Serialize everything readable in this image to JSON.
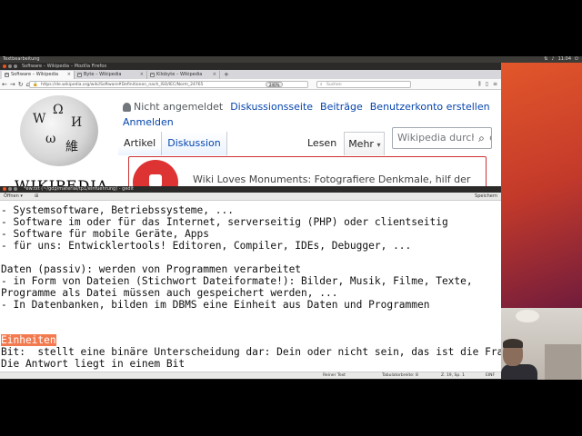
{
  "top_panel": {
    "app_title": "Textbearbeitung",
    "clock": "11:04"
  },
  "firefox": {
    "window_title": "Software – Wikipedia – Mozilla Firefox",
    "tabs": [
      {
        "label": "Software – Wikipedia",
        "active": true
      },
      {
        "label": "Byte – Wikipedia",
        "active": false
      },
      {
        "label": "Kilobyte – Wikipedia",
        "active": false
      }
    ],
    "new_tab": "+",
    "url": "https://de.wikipedia.org/wiki/Software#Definitionen_nach_ISO/IEC/Norm_24765",
    "zoom": "240%",
    "search_placeholder": "Suchen"
  },
  "wikipedia": {
    "wordmark": "WIKIPEDIA",
    "not_logged_in": "Nicht angemeldet",
    "personal_links": [
      "Diskussionsseite",
      "Beiträge",
      "Benutzerkonto erstellen"
    ],
    "login": "Anmelden",
    "namespace_tabs": [
      "Artikel",
      "Diskussion"
    ],
    "view_tabs": {
      "read": "Lesen",
      "more": "Mehr"
    },
    "search_placeholder": "Wikipedia durchsuchen",
    "banner_text": "Wiki Loves Monuments: Fotografiere Denkmale, hilf der"
  },
  "gedit": {
    "window_title": "*ew.txt (~/gdp/material/tp1/einfuehrung) - gedit",
    "open_label": "Öffnen",
    "save_label": "Speichern",
    "lines": [
      "- Systemsoftware, Betriebssysteme, ...",
      "- Software im oder für das Internet, serverseitig (PHP) oder clientseitig",
      "- Software für mobile Geräte, Apps",
      "- für uns: Entwicklertools! Editoren, Compiler, IDEs, Debugger, ...",
      "",
      "Daten (passiv): werden von Programmen verarbeitet",
      "- in Form von Dateien (Stichwort Dateiformate!): Bilder, Musik, Filme, Texte,",
      "Programme als Datei müssen auch gespeichert werden, ...",
      "- In Datenbanken, bilden im DBMS eine Einheit aus Daten und Programmen",
      "",
      "",
      "Einheiten",
      "Bit:  stellt eine binäre Unterscheidung dar: Dein oder nicht sein, das ist die Frage!",
      "Die Antwort liegt in einem Bit"
    ],
    "status": {
      "syntax": "Reiner Text",
      "tab_width": "Tabulatorbreite: 8",
      "position": "Z. 19, Sp. 1",
      "mode": "EINF"
    }
  },
  "colors": {
    "ubuntu_orange": "#e95420",
    "highlight": "#f37a4e",
    "wiki_link": "#0645ad"
  }
}
